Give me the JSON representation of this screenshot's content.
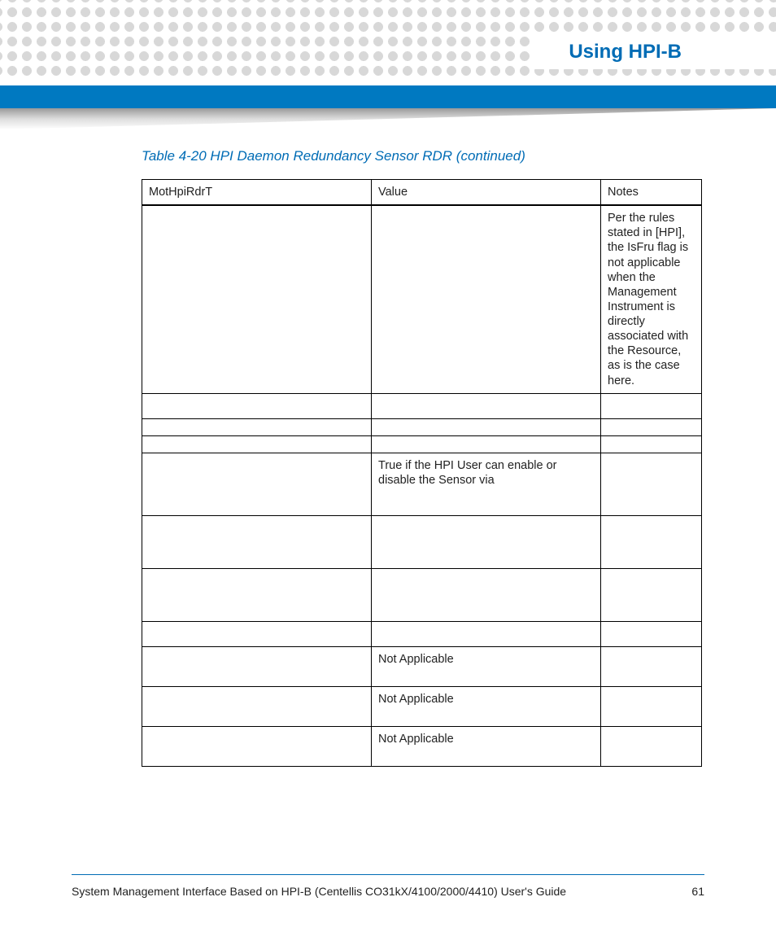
{
  "header": {
    "chapter_title": "Using HPI-B"
  },
  "table_caption": "Table 4-20 HPI Daemon Redundancy Sensor RDR (continued)",
  "table": {
    "headers": [
      "MotHpiRdrT",
      "Value",
      "Notes"
    ],
    "rows": [
      {
        "col1": "",
        "col2": "",
        "col3": "Per the rules stated in [HPI], the IsFru flag is not applicable when the Management Instrument is directly associated with the Resource, as is the case here.",
        "cls": "tight"
      },
      {
        "col1": "",
        "col2": "",
        "col3": "",
        "cls": ""
      },
      {
        "col1": "",
        "col2": "",
        "col3": "",
        "cls": ""
      },
      {
        "col1": "",
        "col2": "",
        "col3": "",
        "cls": ""
      },
      {
        "col1": "",
        "col2": "True if the HPI User can enable or disable the Sensor via",
        "col3": "",
        "cls": ""
      },
      {
        "col1": "",
        "col2": "",
        "col3": "",
        "cls": "tall"
      },
      {
        "col1": "",
        "col2": "",
        "col3": "",
        "cls": "tall"
      },
      {
        "col1": "",
        "col2": "",
        "col3": "",
        "cls": ""
      },
      {
        "col1": "",
        "col2": "Not Applicable",
        "col3": "",
        "cls": ""
      },
      {
        "col1": "",
        "col2": "Not Applicable",
        "col3": "",
        "cls": ""
      },
      {
        "col1": "",
        "col2": "Not Applicable",
        "col3": "",
        "cls": ""
      }
    ]
  },
  "footer": {
    "doc_title": "System Management Interface Based on HPI-B (Centellis CO31kX/4100/2000/4410) User's Guide",
    "page_number": "61"
  }
}
